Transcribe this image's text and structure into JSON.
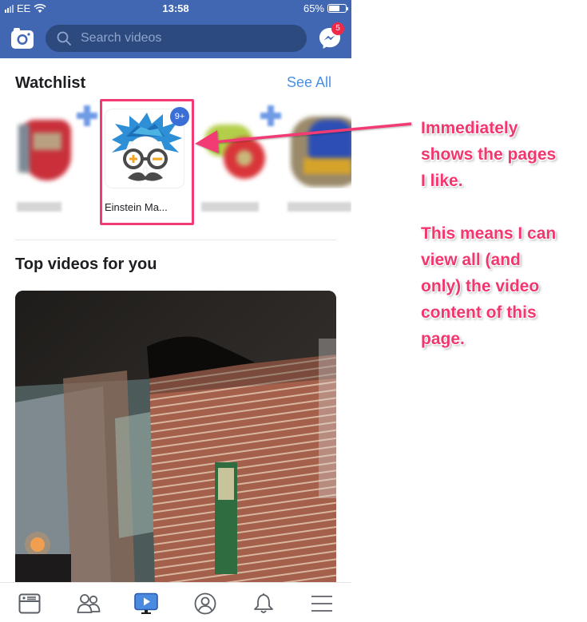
{
  "status_bar": {
    "carrier": "EE",
    "time": "13:58",
    "battery_percent": "65%",
    "battery_level": 0.65
  },
  "header": {
    "search_placeholder": "Search videos",
    "messenger_badge": "5",
    "icons": [
      "camera-icon",
      "search-icon",
      "messenger-icon"
    ],
    "background_color": "#4267b2"
  },
  "watchlist": {
    "title": "Watchlist",
    "see_all_label": "See All",
    "see_all_color": "#4a90e2",
    "items": [
      {
        "label": "(blurred)",
        "blurred": true
      },
      {
        "label": "Einstein Ma...",
        "badge": "9+",
        "highlighted": true
      },
      {
        "label": "(blurred)",
        "blurred": true
      },
      {
        "label": "(blurred)",
        "blurred": true
      }
    ]
  },
  "top_videos": {
    "title": "Top videos for you"
  },
  "tab_bar": {
    "tabs": [
      {
        "name": "news-feed",
        "icon": "news-feed-icon",
        "active": false
      },
      {
        "name": "friends",
        "icon": "friends-icon",
        "active": false
      },
      {
        "name": "watch",
        "icon": "watch-tv-icon",
        "active": true
      },
      {
        "name": "profile",
        "icon": "profile-icon",
        "active": false
      },
      {
        "name": "notifications",
        "icon": "bell-icon",
        "active": false
      },
      {
        "name": "menu",
        "icon": "menu-icon",
        "active": false
      }
    ],
    "active_color": "#4267b2"
  },
  "annotation": {
    "lines_1": [
      "Immediately",
      "shows the pages",
      "I like."
    ],
    "lines_2": [
      "This means I can",
      "view all (and",
      "only) the video",
      "content of this",
      "page."
    ],
    "color": "#f2366e"
  }
}
